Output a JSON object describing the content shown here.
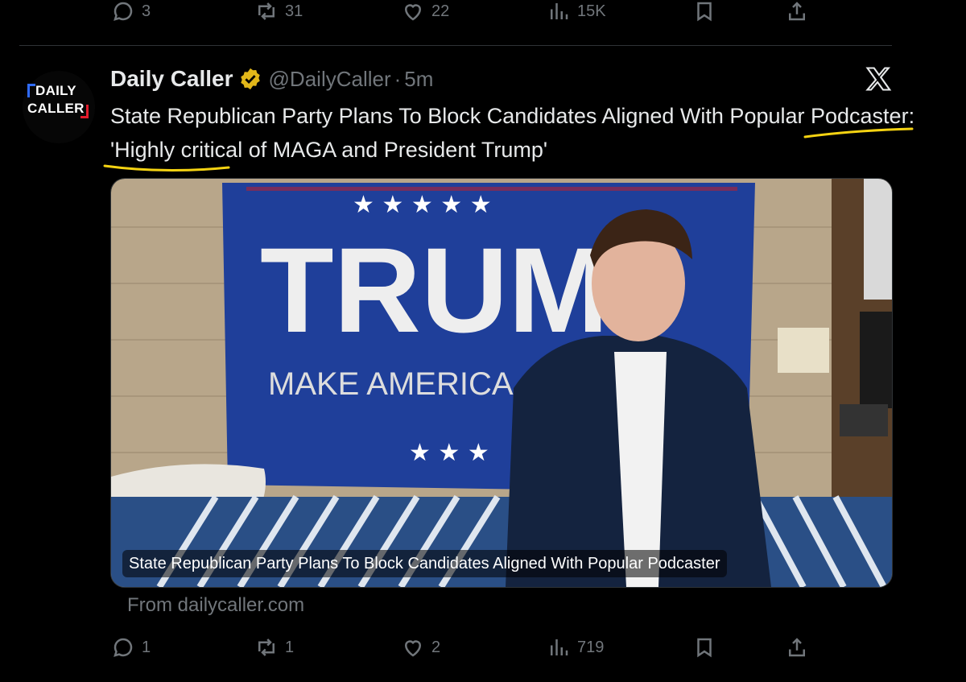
{
  "top_actions": {
    "replies": "3",
    "reposts": "31",
    "likes": "22",
    "views": "15K"
  },
  "tweet": {
    "avatar_text_line1": "DAILY",
    "avatar_text_line2": "CALLER",
    "author_name": "Daily Caller",
    "author_handle": "@DailyCaller",
    "separator": "·",
    "time": "5m",
    "headline": "State Republican Party Plans To Block Candidates Aligned With Popular Podcaster: 'Highly critical of MAGA and President Trump'",
    "card": {
      "caption": "State Republican Party Plans To Block Candidates Aligned With Popular Podcaster",
      "flag_text_big": "TRUM",
      "flag_text_small": "MAKE AMERICA G",
      "source": "From dailycaller.com"
    },
    "actions": {
      "replies": "1",
      "reposts": "1",
      "likes": "2",
      "views": "719"
    }
  },
  "colors": {
    "background": "#000000",
    "text": "#e7e9ea",
    "muted": "#71767b",
    "verified": "#e2b719",
    "highlight": "#f5d312",
    "logo_accent_blue": "#2f6bff",
    "logo_accent_red": "#e21b2c"
  },
  "icons": [
    "reply-icon",
    "repost-icon",
    "like-icon",
    "views-icon",
    "bookmark-icon",
    "share-icon",
    "verified-badge-icon",
    "x-logo-icon"
  ]
}
